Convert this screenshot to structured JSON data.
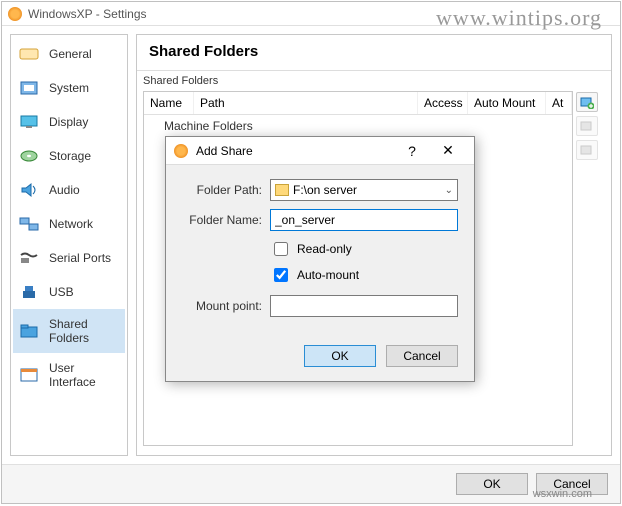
{
  "window": {
    "title": "WindowsXP - Settings"
  },
  "watermark": "www.wintips.org",
  "watermark2": "wsxwin.com",
  "sidebar": {
    "items": [
      {
        "label": "General"
      },
      {
        "label": "System"
      },
      {
        "label": "Display"
      },
      {
        "label": "Storage"
      },
      {
        "label": "Audio"
      },
      {
        "label": "Network"
      },
      {
        "label": "Serial Ports"
      },
      {
        "label": "USB"
      },
      {
        "label": "Shared Folders"
      },
      {
        "label": "User Interface"
      }
    ]
  },
  "main": {
    "header": "Shared Folders",
    "group_label": "Shared Folders",
    "columns": {
      "name": "Name",
      "path": "Path",
      "access": "Access",
      "auto": "Auto Mount",
      "at": "At"
    },
    "machine_folders": "Machine Folders"
  },
  "dialog": {
    "title": "Add Share",
    "folder_path_label": "Folder Path:",
    "folder_path_value": "F:\\on server",
    "folder_name_label": "Folder Name:",
    "folder_name_value": "_on_server",
    "readonly_label": "Read-only",
    "readonly_checked": false,
    "automount_label": "Auto-mount",
    "automount_checked": true,
    "mount_label": "Mount point:",
    "mount_value": "",
    "ok": "OK",
    "cancel": "Cancel"
  },
  "footer": {
    "ok": "OK",
    "cancel": "Cancel"
  }
}
